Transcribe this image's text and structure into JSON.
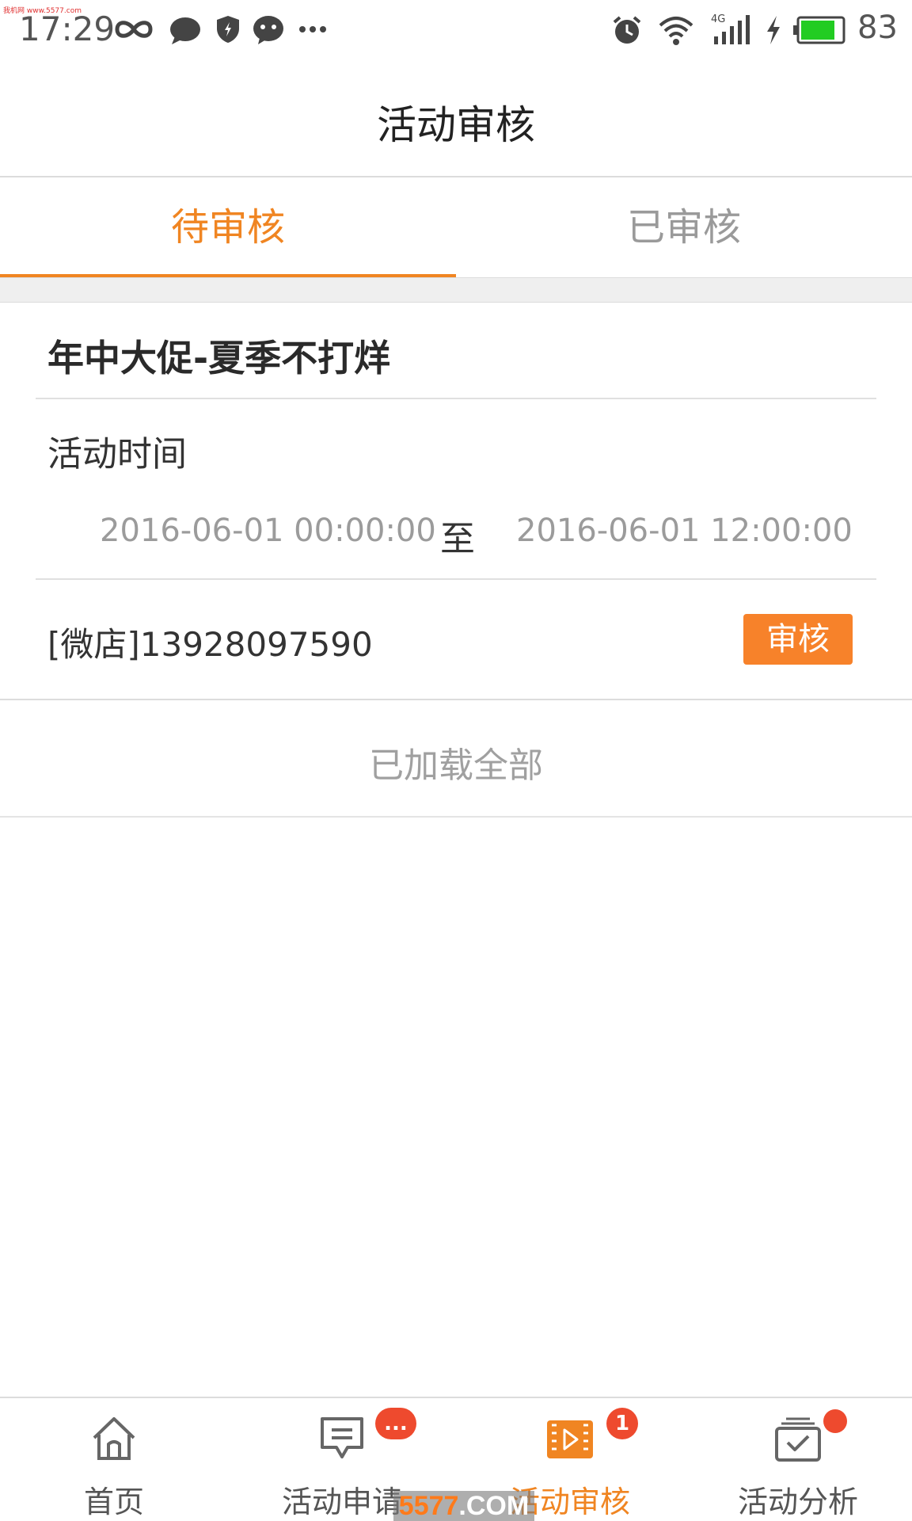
{
  "status_bar": {
    "time": "17:29",
    "battery_percent": "83",
    "watermark": "我机网 www.5577.com",
    "icons": [
      "infinity-icon",
      "chat-bubble-icon",
      "shield-icon",
      "messenger-icon",
      "more-dots-icon",
      "alarm-icon",
      "wifi-icon",
      "signal-4g-icon",
      "charging-icon",
      "battery-icon"
    ],
    "battery_level": 0.83,
    "battery_color": "#22cc22"
  },
  "header": {
    "title": "活动审核"
  },
  "tabs": [
    {
      "label": "待审核",
      "active": true
    },
    {
      "label": "已审核",
      "active": false
    }
  ],
  "card": {
    "title": "年中大促-夏季不打烊",
    "time_label": "活动时间",
    "start_time": "2016-06-01 00:00:00",
    "separator": "至",
    "end_time": "2016-06-01 12:00:00",
    "shop": "[微店]13928097590",
    "audit_button": "审核"
  },
  "list_footer": "已加载全部",
  "bottom_nav": [
    {
      "label": "首页",
      "icon": "home-icon",
      "badge": ""
    },
    {
      "label": "活动申请",
      "icon": "message-icon",
      "badge": "..."
    },
    {
      "label": "活动审核",
      "icon": "video-review-icon",
      "badge": "1",
      "active": true
    },
    {
      "label": "活动分析",
      "icon": "checkbox-stack-icon",
      "badge": "dot"
    }
  ],
  "watermark_bottom": {
    "prefix": "5577",
    "suffix": ".COM"
  },
  "colors": {
    "accent": "#f08522",
    "button": "#f7822a",
    "badge": "#ee4a2e"
  }
}
